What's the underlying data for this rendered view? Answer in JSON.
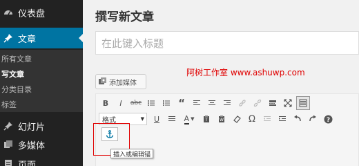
{
  "sidebar": {
    "items": [
      {
        "label": "仪表盘",
        "icon": "dashboard-icon"
      },
      {
        "label": "文章",
        "icon": "pin-icon",
        "current": true
      },
      {
        "label": "幻灯片",
        "icon": "pin-icon"
      },
      {
        "label": "多媒体",
        "icon": "media-icon"
      },
      {
        "label": "页面",
        "icon": "page-icon"
      }
    ],
    "submenu": [
      "所有文章",
      "写文章",
      "分类目录",
      "标签"
    ]
  },
  "main": {
    "page_title": "撰写新文章",
    "title_placeholder": "在此键入标题",
    "add_media_label": "添加媒体",
    "watermark": "阿树工作室 www.ashuwp.com"
  },
  "toolbar": {
    "row1_icons": [
      "bold-icon",
      "italic-icon",
      "strikethrough-icon",
      "bullet-list-icon",
      "numbered-list-icon",
      "blockquote-icon",
      "align-left-icon",
      "align-center-icon",
      "align-right-icon",
      "link-icon",
      "unlink-icon",
      "more-tag-icon",
      "fullscreen-icon",
      "kitchen-sink-icon"
    ],
    "format_value": "格式",
    "row2_icons": [
      "underline-icon",
      "justify-icon",
      "text-color-icon",
      "paste-text-icon",
      "paste-word-icon",
      "clear-format-icon",
      "special-char-icon",
      "outdent-icon",
      "indent-icon",
      "undo-icon",
      "redo-icon",
      "help-icon"
    ],
    "anchor_icon": "anchor-icon",
    "anchor_tooltip": "插入或编辑锚"
  },
  "colors": {
    "sidebar_bg": "#222222",
    "current_bg": "#0074a2",
    "accent_red": "#e00000"
  }
}
